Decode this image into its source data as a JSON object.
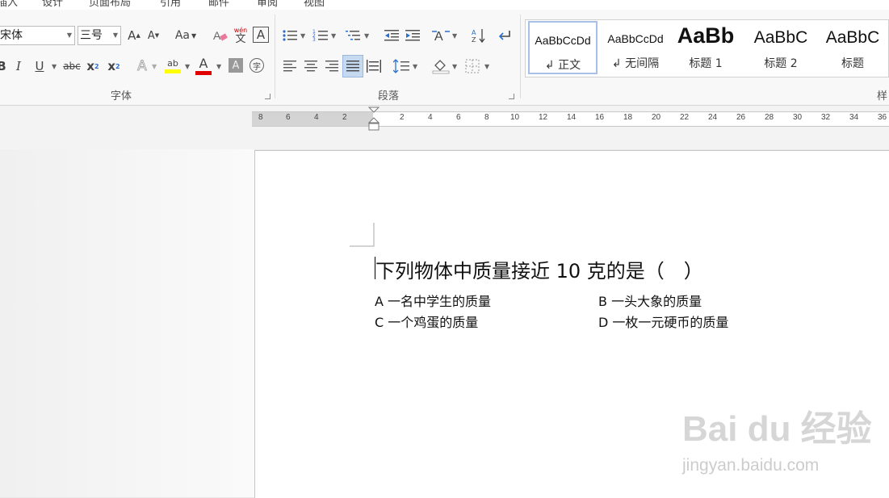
{
  "tabs": [
    "插入",
    "设计",
    "页面布局",
    "引用",
    "邮件",
    "审阅",
    "视图"
  ],
  "font": {
    "name": "宋体",
    "size": "三号",
    "grow_label": "A",
    "shrink_label": "A",
    "case_label": "Aa",
    "phonetic_top": "wén",
    "phonetic_bottom": "文",
    "border_char": "A",
    "bold": "B",
    "italic": "I",
    "underline": "U",
    "strike": "abc",
    "subscript": "x",
    "subscript_mark": "2",
    "superscript": "x",
    "superscript_mark": "2",
    "effects": "A",
    "highlight_text": "ab",
    "font_color_letter": "A",
    "shading_letter": "A",
    "enclose_char": "字",
    "highlight_color": "#ffff00",
    "font_color": "#e00000",
    "group_label": "字体"
  },
  "paragraph": {
    "group_label": "段落"
  },
  "styles": {
    "items": [
      {
        "sample": "AaBbCcDd",
        "caption": "↲ 正文"
      },
      {
        "sample": "AaBbCcDd",
        "caption": "↲ 无间隔"
      },
      {
        "sample": "AaBb",
        "caption": "标题 1"
      },
      {
        "sample": "AaBbC",
        "caption": "标题 2"
      },
      {
        "sample": "AaBbC",
        "caption": "标题"
      }
    ],
    "group_label": "样"
  },
  "ruler": {
    "left_numbers": [
      "8",
      "6",
      "4",
      "2"
    ],
    "right_numbers": [
      "2",
      "4",
      "6",
      "8",
      "10",
      "12",
      "14",
      "16",
      "18",
      "20",
      "22",
      "24",
      "26",
      "28",
      "30",
      "32",
      "34",
      "36"
    ]
  },
  "document": {
    "question": "下列物体中质量接近 10 克的是（　）",
    "options": {
      "a": "A 一名中学生的质量",
      "b": "B 一头大象的质量",
      "c": "C 一个鸡蛋的质量",
      "d": "D 一枚一元硬币的质量"
    }
  },
  "watermark": {
    "logo": "Bai du 经验",
    "url": "jingyan.baidu.com"
  },
  "colors": {
    "accent_selected": "#c5d9f1",
    "ribbon_bg": "#f8f8f8"
  }
}
